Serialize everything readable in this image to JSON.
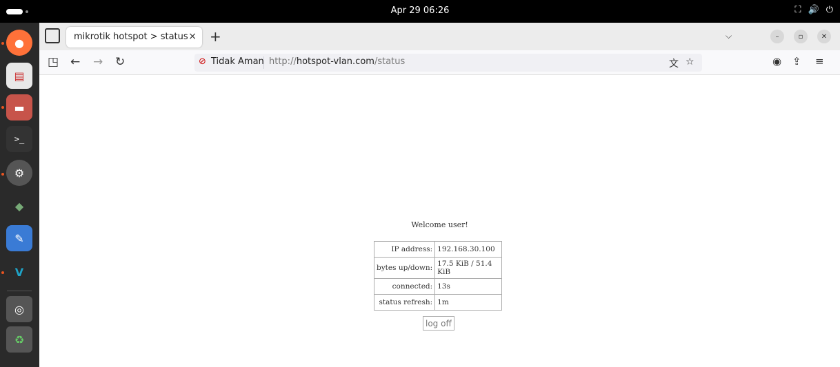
{
  "topbar": {
    "clock": "Apr 29  06:26"
  },
  "dock": {
    "items": [
      "firefox-icon",
      "text-editor-icon",
      "files-icon",
      "terminal-icon",
      "settings-icon",
      "network-icon",
      "notes-icon",
      "vscode-icon",
      "disk-icon",
      "trash-icon"
    ]
  },
  "browser": {
    "tab": {
      "title": "mikrotik hotspot > status",
      "close": "×"
    },
    "newtab": "+",
    "urlbar": {
      "security_label": "Tidak Aman",
      "scheme": "http://",
      "host": "hotspot-vlan.com",
      "path": "/status"
    }
  },
  "page": {
    "welcome": "Welcome user!",
    "rows": [
      {
        "key": "IP address:",
        "value": "192.168.30.100"
      },
      {
        "key": "bytes up/down:",
        "value": "17.5 KiB / 51.4 KiB"
      },
      {
        "key": "connected:",
        "value": "13s"
      },
      {
        "key": "status refresh:",
        "value": "1m"
      }
    ],
    "logoff_label": "log off"
  }
}
